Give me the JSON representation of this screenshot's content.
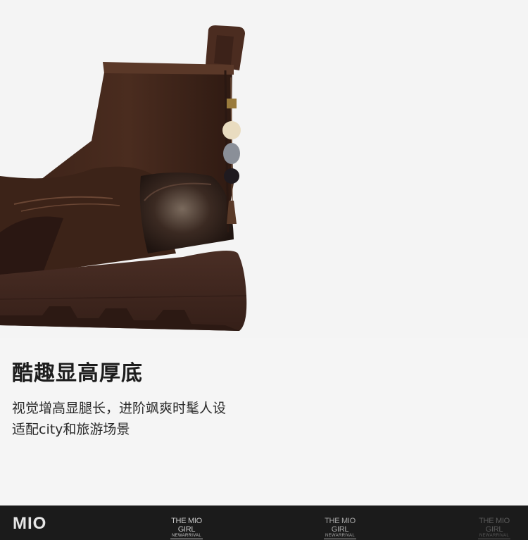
{
  "headline": "酷趣显高厚底",
  "description": {
    "line1": "视觉增高显腿长，进阶飒爽时髦人设",
    "line2": "适配city和旅游场景"
  },
  "footer": {
    "logo": "MIO",
    "marks": [
      {
        "title": "THE MIO GIRL",
        "subtitle": "NEWARRIVAL"
      },
      {
        "title": "THE MIO GIRL",
        "subtitle": "NEWARRIVAL"
      },
      {
        "title": "THE MIO GIRL",
        "subtitle": "NEWARRIVAL"
      }
    ]
  }
}
